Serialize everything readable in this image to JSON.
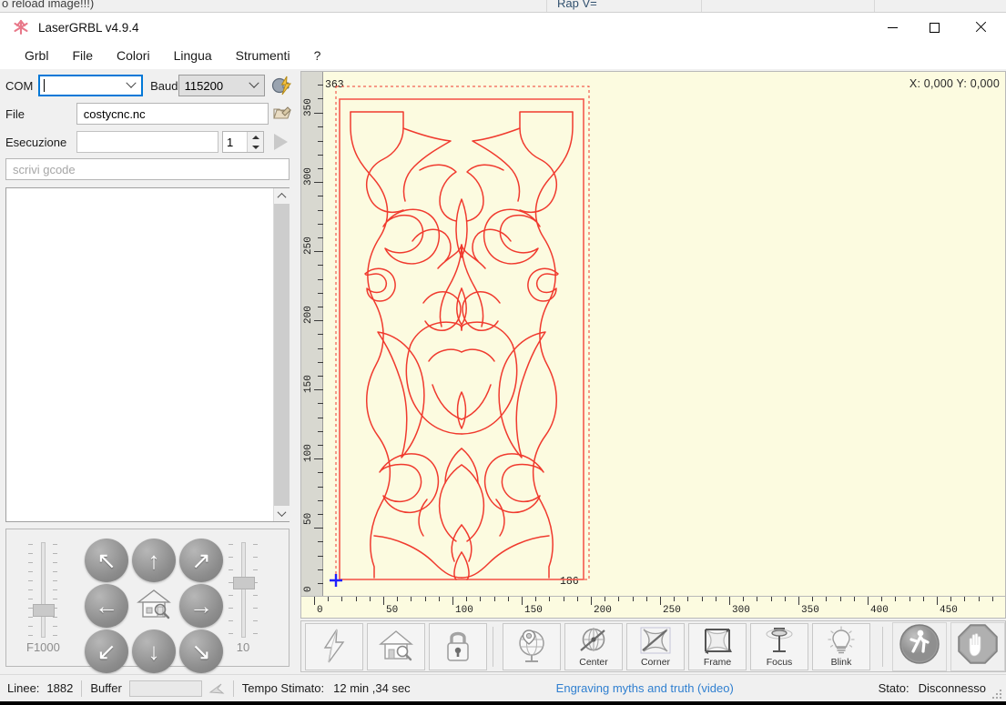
{
  "background_window": {
    "left_text": "o reload image!!!)",
    "mid_text": "Rap V="
  },
  "titlebar": {
    "app_name": "LaserGRBL v4.9.4",
    "icon": "lasergrbl-logo-icon",
    "minimize": "–",
    "maximize": "□",
    "close": "✕"
  },
  "menubar": {
    "items": [
      {
        "label": "Grbl",
        "name": "menu-grbl"
      },
      {
        "label": "File",
        "name": "menu-file"
      },
      {
        "label": "Colori",
        "name": "menu-colori"
      },
      {
        "label": "Lingua",
        "name": "menu-lingua"
      },
      {
        "label": "Strumenti",
        "name": "menu-strumenti"
      },
      {
        "label": "?",
        "name": "menu-help"
      }
    ]
  },
  "connection": {
    "com_label": "COM",
    "com_value": "",
    "baud_label": "Baud",
    "baud_value": "115200",
    "connect_icon": "connect-plug-lightning-icon"
  },
  "file_row": {
    "label": "File",
    "value": "costycnc.nc",
    "open_icon": "open-folder-icon"
  },
  "execution_row": {
    "label": "Esecuzione",
    "progress_value": "",
    "repeat_count": "1",
    "run_icon": "play-run-icon"
  },
  "gcode_input": {
    "placeholder": "scrivi gcode",
    "value": ""
  },
  "console": {
    "lines": []
  },
  "jog": {
    "buttons": [
      {
        "name": "jog-up-left",
        "glyph": "↖"
      },
      {
        "name": "jog-up",
        "glyph": "↑"
      },
      {
        "name": "jog-up-right",
        "glyph": "↗"
      },
      {
        "name": "jog-left",
        "glyph": "←"
      },
      {
        "name": "jog-home",
        "glyph": "home-icon"
      },
      {
        "name": "jog-right",
        "glyph": "→"
      },
      {
        "name": "jog-down-left",
        "glyph": "↙"
      },
      {
        "name": "jog-down",
        "glyph": "↓"
      },
      {
        "name": "jog-down-right",
        "glyph": "↘"
      }
    ],
    "feed_label": "F1000",
    "step_label": "10"
  },
  "canvas": {
    "coordinates": "X: 0,000 Y: 0,000",
    "bbox_width_label": "186",
    "bbox_height_label": "363",
    "origin_label": "0",
    "x_ticks": [
      "0",
      "50",
      "100",
      "150",
      "200",
      "250",
      "300",
      "350",
      "400",
      "450"
    ],
    "y_ticks": [
      "0",
      "50",
      "100",
      "150",
      "200",
      "250",
      "300",
      "350"
    ],
    "background_color": "#fcfbe0",
    "path_color": "#f03a2e"
  },
  "toolbar": {
    "buttons": [
      {
        "name": "unlock-alarm-button",
        "caption": "",
        "icon": "lightning-bolt-icon"
      },
      {
        "name": "home-button",
        "caption": "",
        "icon": "house-search-icon"
      },
      {
        "name": "safety-lock-button",
        "caption": "",
        "icon": "padlock-icon"
      },
      {
        "name": "set-origin-button",
        "caption": "",
        "icon": "globe-pin-icon"
      },
      {
        "name": "center-button",
        "caption": "Center",
        "icon": "center-crosshair-icon"
      },
      {
        "name": "corner-button",
        "caption": "Corner",
        "icon": "corner-target-icon"
      },
      {
        "name": "frame-button",
        "caption": "Frame",
        "icon": "frame-arrows-icon"
      },
      {
        "name": "focus-button",
        "caption": "Focus",
        "icon": "focus-laser-icon"
      },
      {
        "name": "blink-button",
        "caption": "Blink",
        "icon": "lightbulb-icon"
      },
      {
        "name": "run-program-button",
        "caption": "",
        "icon": "walking-man-icon"
      },
      {
        "name": "stop-program-button",
        "caption": "",
        "icon": "stop-hand-icon"
      }
    ]
  },
  "statusbar": {
    "lines_label": "Linee:",
    "lines_value": "1882",
    "buffer_label": "Buffer",
    "time_label": "Tempo Stimato:",
    "time_value": "12 min ,34 sec",
    "link_text": "Engraving myths and truth (video)",
    "state_label": "Stato:",
    "state_value": "Disconnesso"
  }
}
